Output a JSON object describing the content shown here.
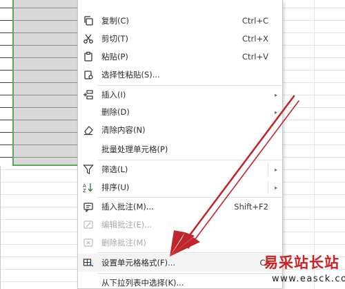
{
  "context_menu": {
    "items": [
      {
        "label": "复制(C)",
        "shortcut": "Ctrl+C",
        "icon": "copy-icon"
      },
      {
        "label": "剪切(T)",
        "shortcut": "Ctrl+X",
        "icon": "scissors-icon"
      },
      {
        "label": "粘贴(P)",
        "shortcut": "Ctrl+V",
        "icon": "paste-icon"
      },
      {
        "label": "选择性粘贴(S)...",
        "icon": "paste-special-icon"
      },
      {
        "label": "插入(I)",
        "icon": "insert-icon",
        "submenu": true
      },
      {
        "label": "删除(D)",
        "submenu": true
      },
      {
        "label": "清除内容(N)",
        "icon": "eraser-icon"
      },
      {
        "label": "批量处理单元格(P)"
      },
      {
        "label": "筛选(L)",
        "icon": "filter-icon",
        "submenu": true
      },
      {
        "label": "排序(U)",
        "icon": "sort-icon",
        "submenu": true
      },
      {
        "label": "插入批注(M)...",
        "shortcut": "Shift+F2",
        "icon": "comment-icon"
      },
      {
        "label": "编辑批注(E)...",
        "icon": "edit-comment-icon",
        "disabled": true
      },
      {
        "label": "删除批注(M)",
        "icon": "delete-comment-icon",
        "disabled": true
      },
      {
        "label": "设置单元格格式(F)...",
        "shortcut": "Ct",
        "icon": "format-cells-icon"
      },
      {
        "label": "从下拉列表中选择(K)..."
      }
    ],
    "submenu_arrow": "▸"
  },
  "watermark": {
    "text": "易采站长站",
    "url": "www.easck.com"
  },
  "colors": {
    "selection_fill": "#d9d9d9",
    "selection_border": "#5aa85a",
    "annotation_arrow": "#c0262b",
    "watermark_red": "#d21e1e"
  }
}
